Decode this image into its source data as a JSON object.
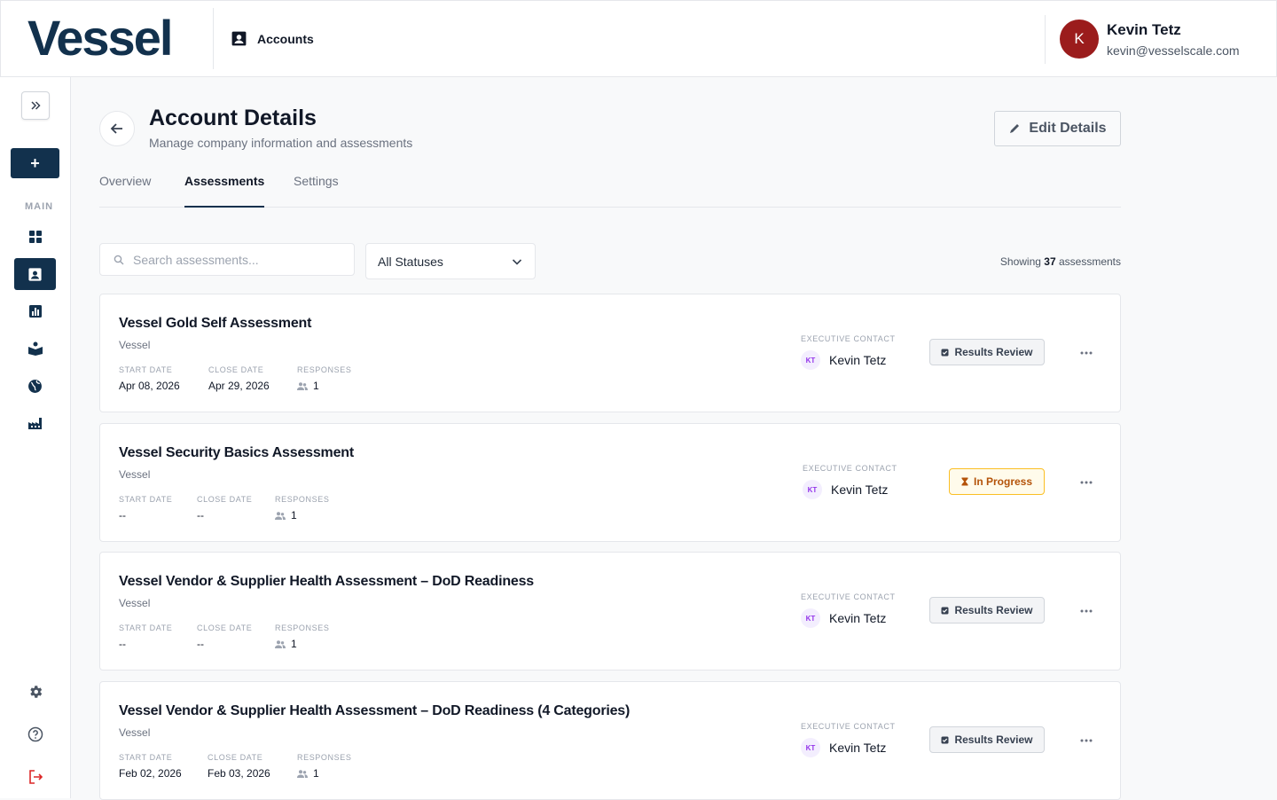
{
  "brand": {
    "logo": "Vessel"
  },
  "topnav": {
    "label": "Accounts"
  },
  "user": {
    "initial": "K",
    "name": "Kevin Tetz",
    "email": "kevin@vesselscale.com"
  },
  "sidebar": {
    "section": "MAIN",
    "add_label": "+"
  },
  "header": {
    "title": "Account Details",
    "subtitle": "Manage company information and assessments",
    "edit_label": "Edit Details"
  },
  "tabs": [
    "Overview",
    "Assessments",
    "Settings"
  ],
  "search": {
    "placeholder": "Search assessments..."
  },
  "filter": {
    "selected": "All Statuses"
  },
  "showing": {
    "prefix": "Showing",
    "count": "37",
    "suffix": "assessments"
  },
  "labels": {
    "start": "START DATE",
    "close": "CLOSE DATE",
    "responses": "RESPONSES",
    "exec": "EXECUTIVE CONTACT",
    "kt": "KT"
  },
  "assessments": [
    {
      "title": "Vessel Gold Self Assessment",
      "company": "Vessel",
      "start": "Apr 08, 2026",
      "close": "Apr 29, 2026",
      "responses": "1",
      "contact": "Kevin Tetz",
      "status": "Results Review"
    },
    {
      "title": "Vessel Security Basics Assessment",
      "company": "Vessel",
      "start": "--",
      "close": "--",
      "responses": "1",
      "contact": "Kevin Tetz",
      "status": "In Progress"
    },
    {
      "title": "Vessel Vendor & Supplier Health Assessment – DoD Readiness",
      "company": "Vessel",
      "start": "--",
      "close": "--",
      "responses": "1",
      "contact": "Kevin Tetz",
      "status": "Results Review"
    },
    {
      "title": "Vessel Vendor & Supplier Health Assessment – DoD Readiness (4 Categories)",
      "company": "Vessel",
      "start": "Feb 02, 2026",
      "close": "Feb 03, 2026",
      "responses": "1",
      "contact": "Kevin Tetz",
      "status": "Results Review"
    }
  ]
}
